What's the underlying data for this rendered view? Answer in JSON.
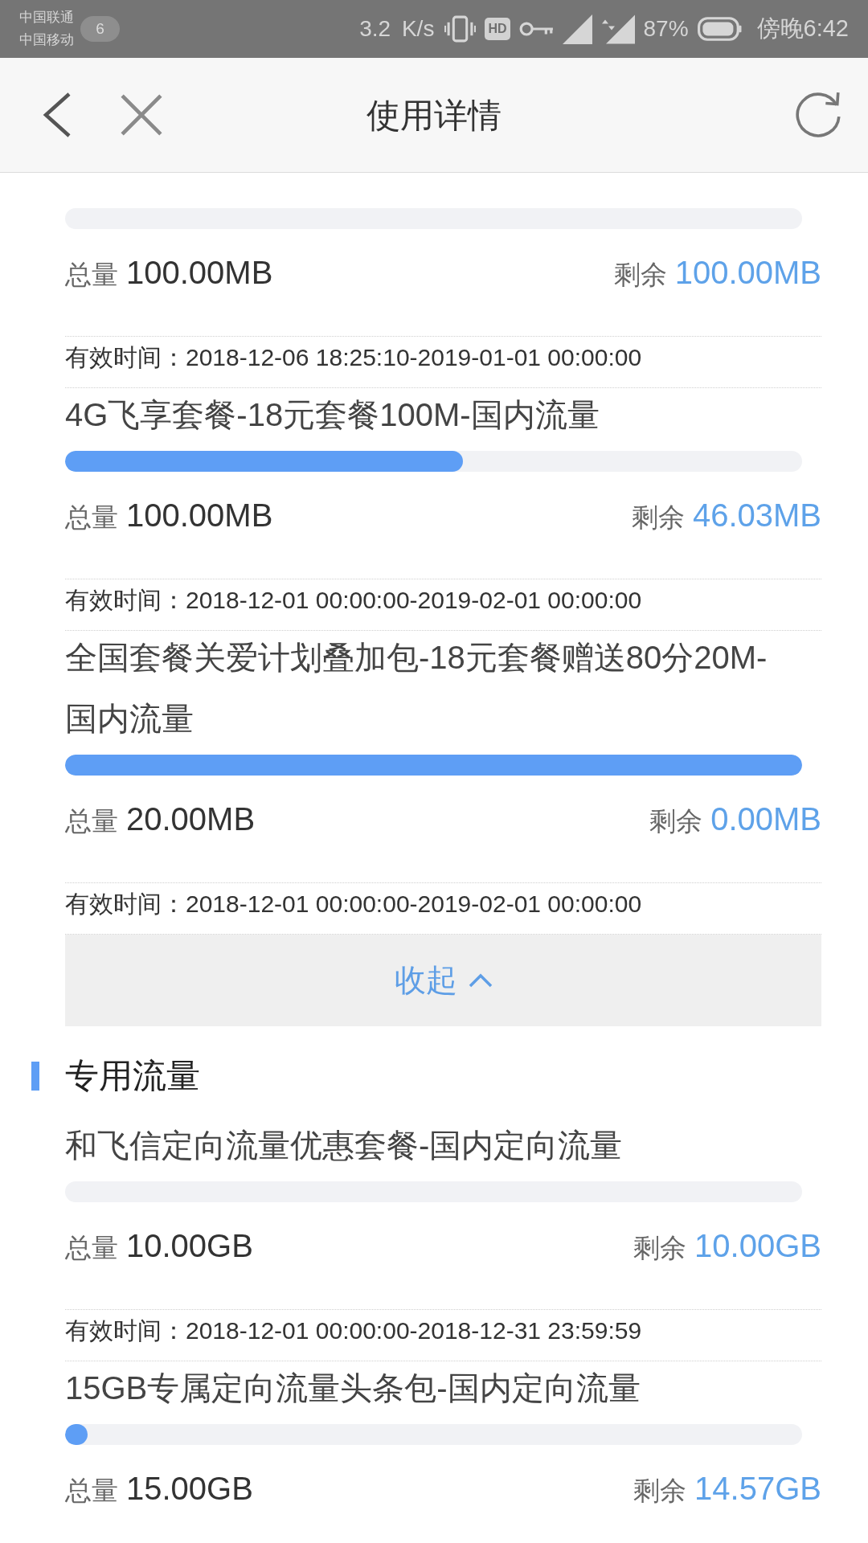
{
  "status_bar": {
    "carriers": [
      "中国联通",
      "中国移动"
    ],
    "notification_count": "6",
    "net_speed": "3.2 K/s",
    "hd": "HD",
    "battery": "87%",
    "time": "傍晚6:42"
  },
  "header": {
    "title": "使用详情"
  },
  "packages": [
    {
      "total_label": "总量",
      "total": "100.00MB",
      "remaining_label": "剩余",
      "remaining": "100.00MB",
      "validity": "有效时间：2018-12-06 18:25:10-2019-01-01 00:00:00"
    },
    {
      "name": "4G飞享套餐-18元套餐100M-国内流量",
      "level": 0.54,
      "total_label": "总量",
      "total": "100.00MB",
      "remaining_label": "剩余",
      "remaining": "46.03MB",
      "validity": "有效时间：2018-12-01 00:00:00-2019-02-01 00:00:00"
    },
    {
      "name": "全国套餐关爱计划叠加包-18元套餐赠送80分20M-国内流量",
      "level": 1,
      "total_label": "总量",
      "total": "20.00MB",
      "remaining_label": "剩余",
      "remaining": "0.00MB",
      "validity": "有效时间：2018-12-01 00:00:00-2019-02-01 00:00:00"
    }
  ],
  "collapse_button": {
    "label": "收起"
  },
  "sections": [
    {
      "title": "专用流量",
      "packages": [
        {
          "name": "和飞信定向流量优惠套餐-国内定向流量",
          "total_label": "总量",
          "total": "10.00GB",
          "remaining_label": "剩余",
          "remaining": "10.00GB",
          "validity": "有效时间：2018-12-01 00:00:00-2018-12-31 23:59:59"
        },
        {
          "name": "15GB专属定向流量头条包-国内定向流量",
          "level": 0.03,
          "total_label": "总量",
          "total": "15.00GB",
          "remaining_label": "剩余",
          "remaining": "14.57GB"
        }
      ]
    }
  ]
}
